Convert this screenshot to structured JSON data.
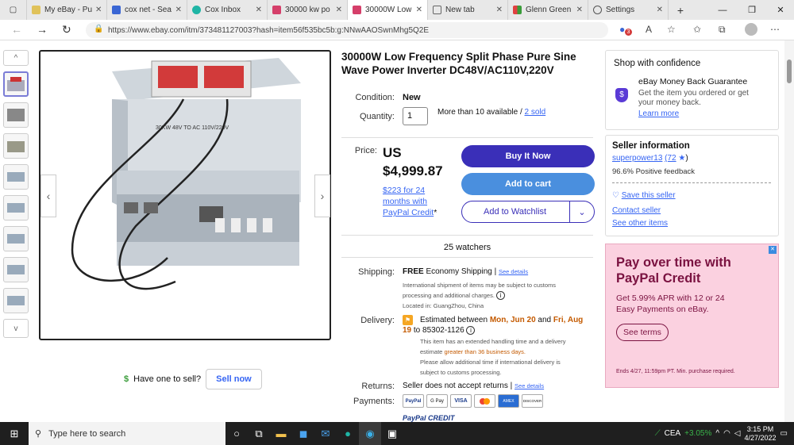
{
  "browser": {
    "tabs": [
      {
        "label": "My eBay - Pu",
        "color": "#e0c25a"
      },
      {
        "label": "cox net - Sea",
        "color": "#3a66d4"
      },
      {
        "label": "Cox Inbox",
        "color": "#1fb5a5"
      },
      {
        "label": "30000 kw po",
        "color": "#d53f6a"
      },
      {
        "label": "30000W Low",
        "color": "#d53f6a",
        "active": true
      },
      {
        "label": "New tab",
        "color": "#666666"
      },
      {
        "label": "Glenn Green",
        "color": "#e04141"
      },
      {
        "label": "Settings",
        "color": "#555555"
      }
    ],
    "new_tab": "+",
    "url": "https://www.ebay.com/itm/373481127003?hash=item56f535bc5b:g:NNwAAOSwnMhg5Q2E",
    "badge": "3"
  },
  "product": {
    "title": "30000W Low Frequency Split Phase Pure Sine Wave Power Inverter DC48V/AC110V,220V",
    "condition_label": "Condition:",
    "condition": "New",
    "quantity_label": "Quantity:",
    "quantity": "1",
    "availability": "More than 10 available /",
    "sold": "2 sold",
    "price_label": "Price:",
    "currency": "US",
    "price": "$4,999.87",
    "financing": "$223 for 24 months with PayPal Credit",
    "financing_mark": "*",
    "buy_now": "Buy It Now",
    "add_cart": "Add to cart",
    "watchlist": "Add to Watchlist",
    "watchers": "25 watchers",
    "shipping_label": "Shipping:",
    "shipping_free": "FREE",
    "shipping_method": "Economy Shipping |",
    "see_details": "See details",
    "shipping_note": "International shipment of items may be subject to customs processing and additional charges.",
    "located": "Located in: GuangZhou, China",
    "delivery_label": "Delivery:",
    "delivery_pre": "Estimated between",
    "delivery_d1": "Mon, Jun 20",
    "delivery_and": "and",
    "delivery_d2": "Fri, Aug 19",
    "delivery_to": "to",
    "zip": "85302-1126",
    "handling": "This item has an extended handling time and a delivery estimate",
    "handling_hl": "greater than 36 business days.",
    "allow": "Please allow additional time if international delivery is subject to customs processing.",
    "returns_label": "Returns:",
    "returns": "Seller does not accept returns |",
    "payments_label": "Payments:",
    "payment_methods": [
      "PayPal",
      "G Pay",
      "VISA",
      "MC",
      "AMEX",
      "DISCOVER"
    ],
    "paypal_credit": "PayPal CREDIT"
  },
  "gallery": {
    "image_label": "30KW 48V TO AC 110V/220V",
    "thumbs": 8
  },
  "sell": {
    "prompt": "Have one to sell?",
    "button": "Sell now"
  },
  "confidence": {
    "title": "Shop with confidence",
    "guarantee": "eBay Money Back Guarantee",
    "desc": "Get the item you ordered or get your money back.",
    "learn": "Learn more"
  },
  "seller": {
    "title": "Seller information",
    "name": "superpower13",
    "score": "(72",
    "feedback": "96.6% Positive feedback",
    "save": "Save this seller",
    "contact": "Contact seller",
    "other": "See other items"
  },
  "ad": {
    "headline": "Pay over time with PayPal Credit",
    "body": "Get 5.99% APR with 12 or 24 Easy Payments on eBay.",
    "cta": "See terms",
    "fine": "Ends 4/27, 11:59pm PT. Min. purchase required."
  },
  "taskbar": {
    "search": "Type here to search",
    "ticker": "CEA",
    "change": "+3.05%",
    "time": "3:15 PM",
    "date": "4/27/2022"
  }
}
